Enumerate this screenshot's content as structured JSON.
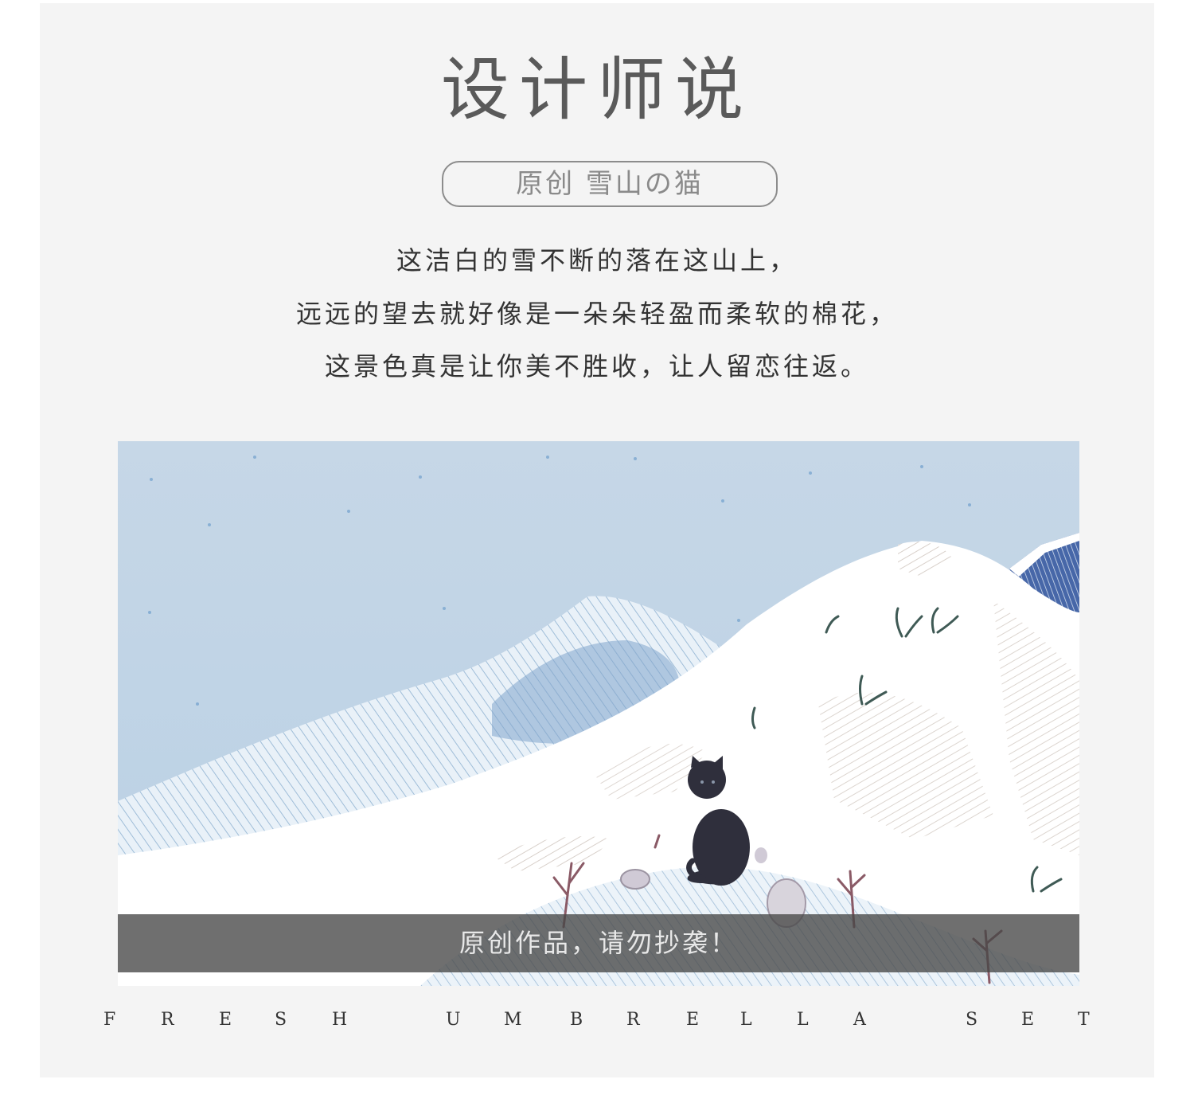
{
  "title": "设计师说",
  "subtitle": "原创 雪山の猫",
  "description": [
    "这洁白的雪不断的落在这山上，",
    "远远的望去就好像是一朵朵轻盈而柔软的棉花，",
    "这景色真是让你美不胜收，让人留恋往返。"
  ],
  "image": {
    "caption": "原创作品，请勿抄袭！"
  },
  "footer_letters": [
    "F",
    "R",
    "E",
    "S",
    "H",
    "U",
    "M",
    "B",
    "R",
    "E",
    "L",
    "L",
    "A",
    "S",
    "E",
    "T"
  ],
  "colors": {
    "panel": "#f4f4f4",
    "sky": "#c4d6e6",
    "title": "#5a5a5a"
  }
}
